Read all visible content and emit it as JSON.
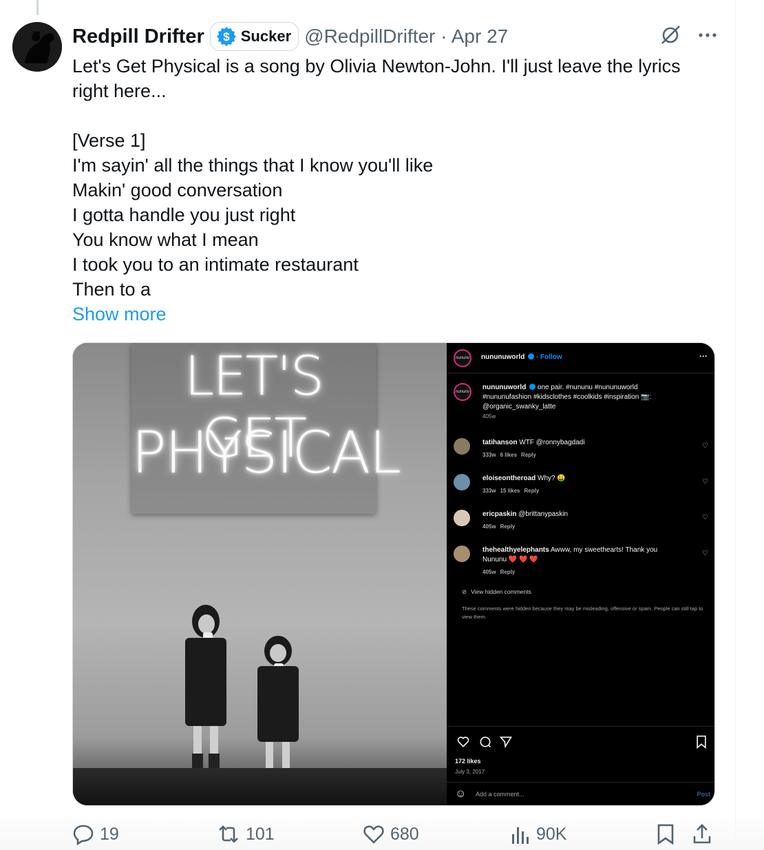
{
  "tweet": {
    "author": {
      "display_name": "Redpill Drifter",
      "subscription_badge": "Sucker",
      "handle": "@RedpillDrifter",
      "date": "· Apr 27"
    },
    "text_lines": [
      "Let's Get Physical is a song by Olivia Newton-John. I'll just leave the lyrics",
      "right here...",
      "",
      "[Verse 1]",
      "I'm sayin' all the things that I know you'll like",
      "Makin' good conversation",
      "I gotta handle you just right",
      "You know what I mean",
      "I took you to an intimate restaurant",
      "Then to a"
    ],
    "show_more": "Show more",
    "icons": {
      "grok": "grok-slash-icon",
      "more": "more-dots-icon"
    }
  },
  "photo": {
    "neon_line1": "LET'S GET",
    "neon_line2": "PHYSICAL"
  },
  "instagram": {
    "avatar_text": "nununu",
    "account": "nununuworld",
    "follow": "Follow",
    "more": "···",
    "caption_user": "nununuworld",
    "caption_text": "one pair. #nununu #nununuworld",
    "caption_text2": "#nununufashion #kidsclothes #coolkids #inspiration 📷:",
    "caption_text3": "@organic_swanky_latte",
    "caption_age": "405w",
    "comments": [
      {
        "user": "tatihanson",
        "text": "WTF @ronnybagdadi",
        "age": "333w",
        "likes": "6 likes",
        "reply": "Reply"
      },
      {
        "user": "eloiseontheroad",
        "text": "Why? 🤑",
        "age": "333w",
        "likes": "15 likes",
        "reply": "Reply"
      },
      {
        "user": "ericpaskin",
        "text": "@brittanypaskin",
        "age": "405w",
        "likes": "",
        "reply": "Reply"
      },
      {
        "user": "thehealthyelephants",
        "text": "Awww, my sweethearts! Thank you",
        "text2": "Nununu ❤️ ❤️ ❤️",
        "age": "405w",
        "likes": "",
        "reply": "Reply"
      }
    ],
    "view_hidden": "View hidden comments",
    "hidden_note": "These comments were hidden because they may be misleading, offensive or spam. People can still tap to view them.",
    "likes": "172 likes",
    "date": "July 3, 2017",
    "add_comment": "Add a comment...",
    "post": "Post"
  },
  "actions": {
    "replies": "19",
    "reposts": "101",
    "likes": "680",
    "views": "90K"
  },
  "colors": {
    "link": "#1d9bf0",
    "muted": "#536471",
    "ig_blue": "#0095f6"
  }
}
